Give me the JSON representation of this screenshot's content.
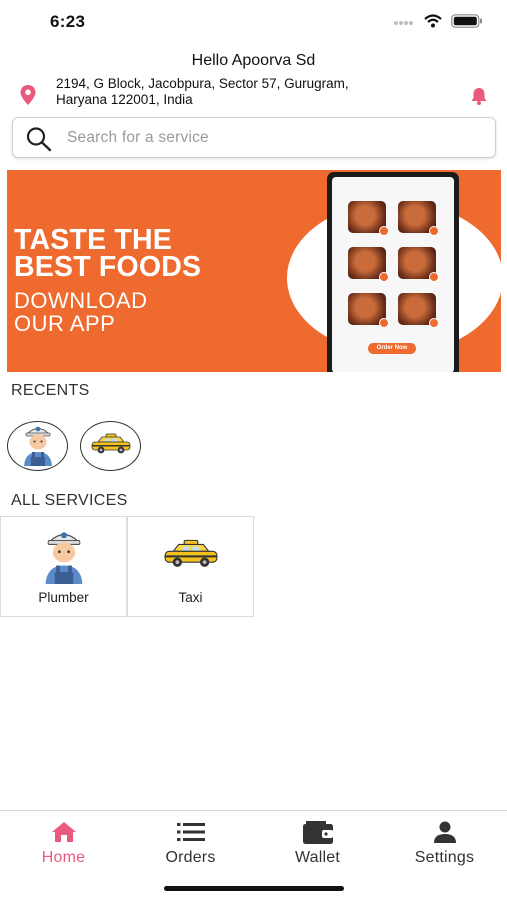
{
  "status_bar": {
    "time": "6:23"
  },
  "header": {
    "greeting": "Hello Apoorva Sd",
    "address_line1": "2194, G Block, Jacobpura, Sector 57, Gurugram,",
    "address_line2": "Haryana 122001, India",
    "icons": {
      "location": "location-pin-icon",
      "notifications": "bell-icon"
    }
  },
  "search": {
    "placeholder": "Search for a service",
    "icon": "search-icon"
  },
  "banner": {
    "headline_line1": "TASTE THE",
    "headline_line2": "BEST FOODS",
    "sub_line1": "DOWNLOAD",
    "sub_line2": "OUR APP",
    "cta": "Order Now",
    "color": "#ee6a2e"
  },
  "recents": {
    "title": "RECENTS",
    "items": [
      {
        "name": "plumber",
        "icon": "plumber-icon"
      },
      {
        "name": "taxi",
        "icon": "taxi-icon"
      }
    ]
  },
  "services": {
    "title": "ALL SERVICES",
    "items": [
      {
        "label": "Plumber",
        "icon": "plumber-icon"
      },
      {
        "label": "Taxi",
        "icon": "taxi-icon"
      }
    ]
  },
  "tabbar": {
    "active": "Home",
    "active_color": "#ea5a7f",
    "items": [
      {
        "label": "Home",
        "icon": "home-icon"
      },
      {
        "label": "Orders",
        "icon": "list-icon"
      },
      {
        "label": "Wallet",
        "icon": "wallet-icon"
      },
      {
        "label": "Settings",
        "icon": "user-icon"
      }
    ]
  }
}
